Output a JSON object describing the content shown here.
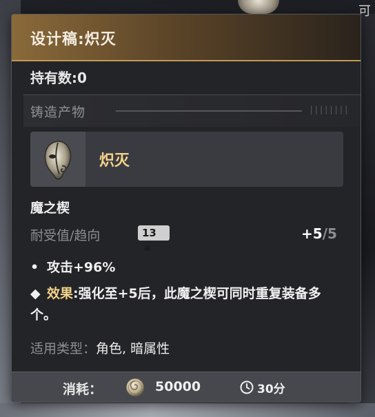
{
  "background": {
    "corner_char": "可"
  },
  "card": {
    "title": "设计稿:炽灭",
    "owned": "持有数:0",
    "section": {
      "label": "铸造产物",
      "ticks": "||||||||"
    },
    "product": {
      "name": "炽灭",
      "icon": "mask-icon"
    },
    "item_name": "魔之楔",
    "durability": {
      "label": "耐受值/趋向",
      "badge": "13",
      "badge_icon": "flame-icon",
      "current": "+5",
      "max": "/5"
    },
    "stats": [
      {
        "marker": "•",
        "text": "攻击+96%"
      },
      {
        "marker": "◆",
        "label": "效果",
        "text": ":强化至+5后，此魔之楔可同时重复装备多个。"
      }
    ],
    "applicable": {
      "label": "适用类型：",
      "value": "角色, 暗属性"
    },
    "footer": {
      "cost_label": "消耗：",
      "cost_icon": "coin-icon",
      "cost_value": "50000",
      "time_icon": "clock-icon",
      "time_value": "30分"
    }
  },
  "colors": {
    "accent_gold": "#f3d28a",
    "title_gold": "#c49a55",
    "panel": "#232427",
    "footer": "#46484d"
  }
}
